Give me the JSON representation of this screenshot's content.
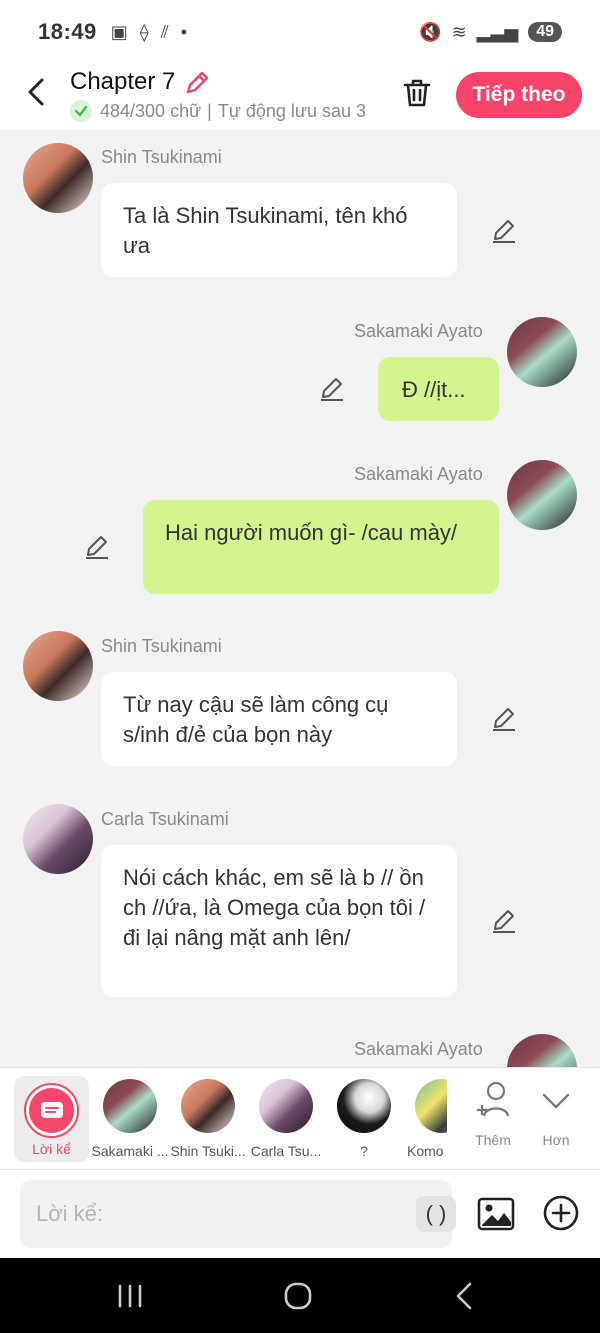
{
  "status_bar": {
    "time": "18:49",
    "battery": "49"
  },
  "header": {
    "title": "Chapter 7",
    "word_count": "484/300 chữ",
    "autosave": "Tự động lưu sau 3",
    "next_label": "Tiếp theo"
  },
  "messages": [
    {
      "side": "left",
      "sender": "Shin Tsukinami",
      "text": "Ta là Shin Tsukinami, tên khó ưa"
    },
    {
      "side": "right",
      "sender": "Sakamaki Ayato",
      "text": "Đ //ịt..."
    },
    {
      "side": "right",
      "sender": "Sakamaki Ayato",
      "text": "Hai người muốn gì- /cau mày/"
    },
    {
      "side": "left",
      "sender": "Shin Tsukinami",
      "text": "Từ nay cậu sẽ làm công cụ s/inh đ/ẻ của bọn này"
    },
    {
      "side": "left",
      "sender": "Carla Tsukinami",
      "text": "Nói cách khác, em sẽ là b // ồn ch //ứa, là Omega của bọn tôi /đi lại nâng mặt anh lên/"
    },
    {
      "side": "right",
      "sender": "Sakamaki Ayato",
      "text": ""
    }
  ],
  "character_bar": {
    "narrator_label": "Lời kể",
    "characters": [
      "Sakamaki ...",
      "Shin Tsuki...",
      "Carla Tsu...",
      "?",
      "Komo"
    ],
    "add_label": "Thêm",
    "more_label": "Hơn"
  },
  "input": {
    "placeholder": "Lời kể:",
    "paren_label": "( )"
  },
  "colors": {
    "accent": "#f5436a",
    "right_bubble": "#d3f48e",
    "left_bubble": "#ffffff"
  }
}
